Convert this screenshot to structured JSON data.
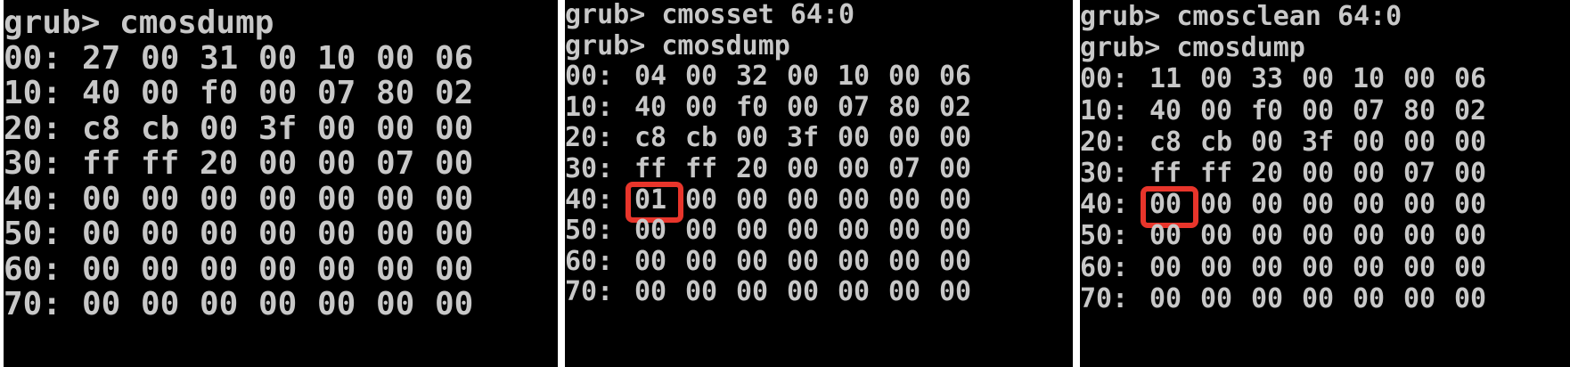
{
  "panels": [
    {
      "prompt_lines": [
        "grub> cmosdump"
      ],
      "rows": [
        {
          "addr": "00:",
          "bytes": [
            "27",
            "00",
            "31",
            "00",
            "10",
            "00",
            "06"
          ]
        },
        {
          "addr": "10:",
          "bytes": [
            "40",
            "00",
            "f0",
            "00",
            "07",
            "80",
            "02"
          ]
        },
        {
          "addr": "20:",
          "bytes": [
            "c8",
            "cb",
            "00",
            "3f",
            "00",
            "00",
            "00"
          ]
        },
        {
          "addr": "30:",
          "bytes": [
            "ff",
            "ff",
            "20",
            "00",
            "00",
            "07",
            "00"
          ]
        },
        {
          "addr": "40:",
          "bytes": [
            "00",
            "00",
            "00",
            "00",
            "00",
            "00",
            "00"
          ]
        },
        {
          "addr": "50:",
          "bytes": [
            "00",
            "00",
            "00",
            "00",
            "00",
            "00",
            "00"
          ]
        },
        {
          "addr": "60:",
          "bytes": [
            "00",
            "00",
            "00",
            "00",
            "00",
            "00",
            "00"
          ]
        },
        {
          "addr": "70:",
          "bytes": [
            "00",
            "00",
            "00",
            "00",
            "00",
            "00",
            "00"
          ]
        }
      ]
    },
    {
      "prompt_lines": [
        "grub> cmosset 64:0",
        "grub> cmosdump"
      ],
      "rows": [
        {
          "addr": "00:",
          "bytes": [
            "04",
            "00",
            "32",
            "00",
            "10",
            "00",
            "06"
          ]
        },
        {
          "addr": "10:",
          "bytes": [
            "40",
            "00",
            "f0",
            "00",
            "07",
            "80",
            "02"
          ]
        },
        {
          "addr": "20:",
          "bytes": [
            "c8",
            "cb",
            "00",
            "3f",
            "00",
            "00",
            "00"
          ]
        },
        {
          "addr": "30:",
          "bytes": [
            "ff",
            "ff",
            "20",
            "00",
            "00",
            "07",
            "00"
          ]
        },
        {
          "addr": "40:",
          "bytes": [
            "01",
            "00",
            "00",
            "00",
            "00",
            "00",
            "00"
          ]
        },
        {
          "addr": "50:",
          "bytes": [
            "00",
            "00",
            "00",
            "00",
            "00",
            "00",
            "00"
          ]
        },
        {
          "addr": "60:",
          "bytes": [
            "00",
            "00",
            "00",
            "00",
            "00",
            "00",
            "00"
          ]
        },
        {
          "addr": "70:",
          "bytes": [
            "00",
            "00",
            "00",
            "00",
            "00",
            "00",
            "00"
          ]
        }
      ]
    },
    {
      "prompt_lines": [
        "grub> cmosclean 64:0",
        "grub> cmosdump"
      ],
      "rows": [
        {
          "addr": "00:",
          "bytes": [
            "11",
            "00",
            "33",
            "00",
            "10",
            "00",
            "06"
          ]
        },
        {
          "addr": "10:",
          "bytes": [
            "40",
            "00",
            "f0",
            "00",
            "07",
            "80",
            "02"
          ]
        },
        {
          "addr": "20:",
          "bytes": [
            "c8",
            "cb",
            "00",
            "3f",
            "00",
            "00",
            "00"
          ]
        },
        {
          "addr": "30:",
          "bytes": [
            "ff",
            "ff",
            "20",
            "00",
            "00",
            "07",
            "00"
          ]
        },
        {
          "addr": "40:",
          "bytes": [
            "00",
            "00",
            "00",
            "00",
            "00",
            "00",
            "00"
          ]
        },
        {
          "addr": "50:",
          "bytes": [
            "00",
            "00",
            "00",
            "00",
            "00",
            "00",
            "00"
          ]
        },
        {
          "addr": "60:",
          "bytes": [
            "00",
            "00",
            "00",
            "00",
            "00",
            "00",
            "00"
          ]
        },
        {
          "addr": "70:",
          "bytes": [
            "00",
            "00",
            "00",
            "00",
            "00",
            "00",
            "00"
          ]
        }
      ]
    }
  ],
  "highlight_color": "#e8352b",
  "text_color": "#c8c8c8",
  "background_color": "#000000"
}
